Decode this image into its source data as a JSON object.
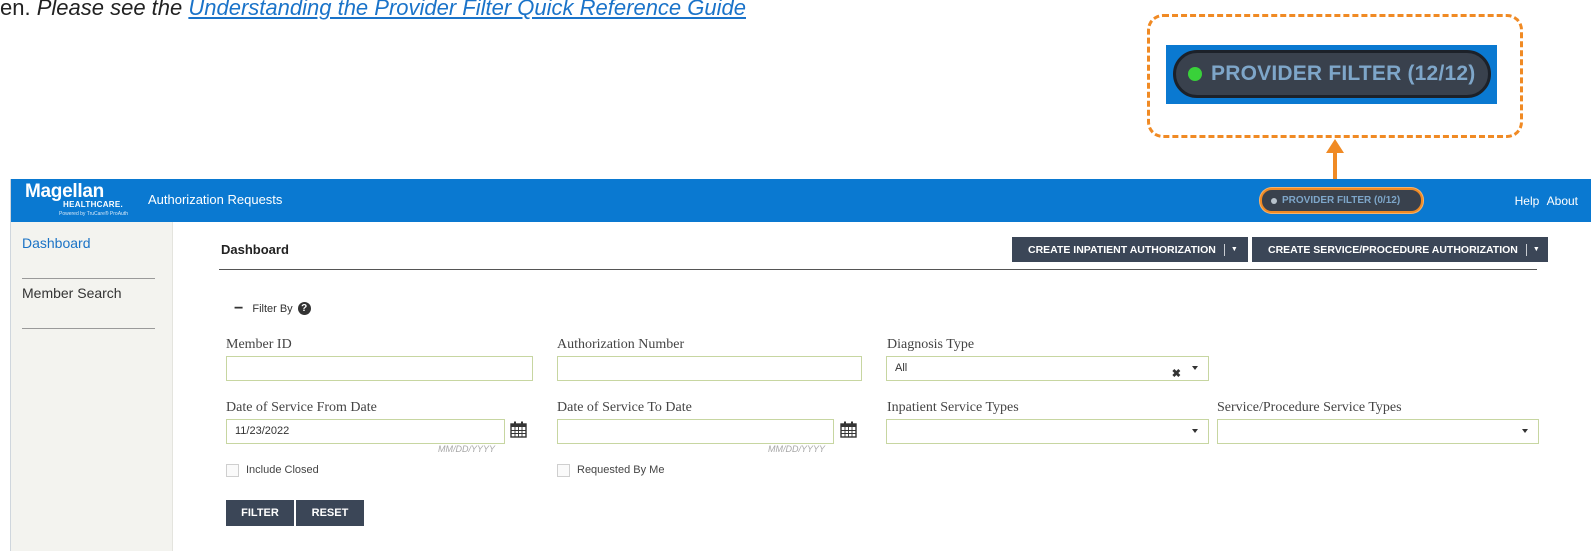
{
  "document": {
    "caption_prefix": "en. ",
    "caption_italic": "Please see  the ",
    "caption_link": "Understanding the Provider Filter Quick Reference Guide"
  },
  "callout": {
    "zoom_label": "PROVIDER FILTER (12/12)",
    "zoom_status_color": "#39d13a",
    "border_color": "#f08a24"
  },
  "header": {
    "logo_brand": "Magellan",
    "logo_sub": "HEALTHCARE.",
    "logo_tiny": "Powered by TruCare® ProAuth",
    "title": "Authorization Requests",
    "provider_filter_label": "PROVIDER FILTER (0/12)",
    "help_link": "Help",
    "about_link": "About",
    "bar_color": "#0a79d1"
  },
  "sidebar": {
    "items": [
      {
        "label": "Dashboard",
        "active": true
      },
      {
        "label": "Member Search",
        "active": false
      }
    ]
  },
  "main": {
    "title": "Dashboard",
    "create_inpatient_label": "CREATE INPATIENT AUTHORIZATION",
    "create_service_label": "CREATE SERVICE/PROCEDURE AUTHORIZATION",
    "filter_by_label": "Filter By"
  },
  "filters": {
    "member_id": {
      "label": "Member ID",
      "value": ""
    },
    "authorization_number": {
      "label": "Authorization Number",
      "value": ""
    },
    "diagnosis_type": {
      "label": "Diagnosis Type",
      "value": "All"
    },
    "date_from": {
      "label": "Date of Service From Date",
      "value": "11/23/2022",
      "hint": "MM/DD/YYYY"
    },
    "date_to": {
      "label": "Date of Service To Date",
      "value": "",
      "hint": "MM/DD/YYYY"
    },
    "inpatient_service_types": {
      "label": "Inpatient Service Types",
      "value": ""
    },
    "service_procedure_types": {
      "label": "Service/Procedure Service Types",
      "value": ""
    },
    "include_closed": {
      "label": "Include Closed",
      "checked": false
    },
    "requested_by_me": {
      "label": "Requested By Me",
      "checked": false
    },
    "filter_button": "FILTER",
    "reset_button": "RESET"
  }
}
